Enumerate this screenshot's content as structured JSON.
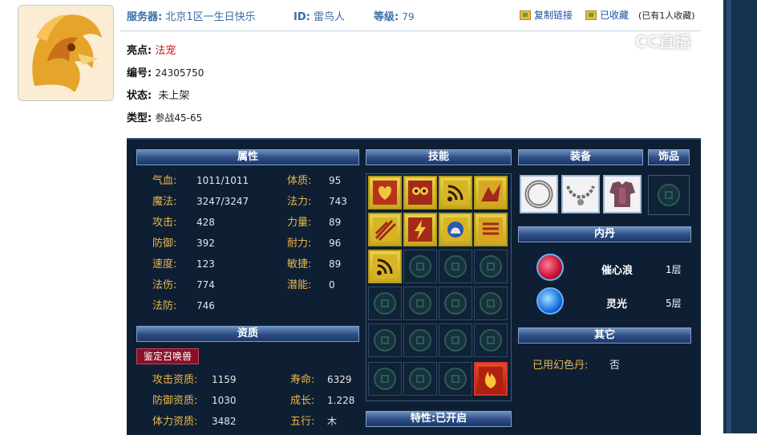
{
  "header": {
    "server_label": "服务器:",
    "server_value": "北京1区一生日快乐",
    "id_label": "ID:",
    "id_value": "雷鸟人",
    "level_label": "等级:",
    "level_value": "79",
    "copy_link": "复制链接",
    "collected": "已收藏",
    "collect_count": "(已有1人收藏)"
  },
  "info": {
    "highlight_label": "亮点:",
    "highlight_value": "法宠",
    "number_label": "编号:",
    "number_value": "24305750",
    "status_label": "状态:",
    "status_value": "未上架",
    "type_label": "类型:",
    "type_value": "参战45-65"
  },
  "attributes": {
    "title": "属性",
    "left": [
      {
        "label": "气血:",
        "value": "1011/1011"
      },
      {
        "label": "魔法:",
        "value": "3247/3247"
      },
      {
        "label": "攻击:",
        "value": "428"
      },
      {
        "label": "防御:",
        "value": "392"
      },
      {
        "label": "速度:",
        "value": "123"
      },
      {
        "label": "法伤:",
        "value": "774"
      },
      {
        "label": "法防:",
        "value": "746"
      }
    ],
    "right": [
      {
        "label": "体质:",
        "value": "95"
      },
      {
        "label": "法力:",
        "value": "743"
      },
      {
        "label": "力量:",
        "value": "89"
      },
      {
        "label": "耐力:",
        "value": "96"
      },
      {
        "label": "敏捷:",
        "value": "89"
      },
      {
        "label": "潜能:",
        "value": "0"
      }
    ]
  },
  "aptitude": {
    "title": "资质",
    "appraise_button": "鉴定召唤兽",
    "left": [
      {
        "label": "攻击资质:",
        "value": "1159"
      },
      {
        "label": "防御资质:",
        "value": "1030"
      },
      {
        "label": "体力资质:",
        "value": "3482"
      }
    ],
    "right": [
      {
        "label": "寿命:",
        "value": "6329"
      },
      {
        "label": "成长:",
        "value": "1.228"
      },
      {
        "label": "五行:",
        "value": "木"
      }
    ]
  },
  "skills": {
    "title": "技能",
    "trait_title": "特性:已开启"
  },
  "equipment": {
    "title": "装备",
    "ornament_title": "饰品"
  },
  "neidan": {
    "title": "内丹",
    "items": [
      {
        "name": "催心浪",
        "level": "1层"
      },
      {
        "name": "灵光",
        "level": "5层"
      }
    ]
  },
  "other": {
    "title": "其它",
    "label": "已用幻色丹:",
    "value": "否"
  },
  "watermark": "CC直播"
}
